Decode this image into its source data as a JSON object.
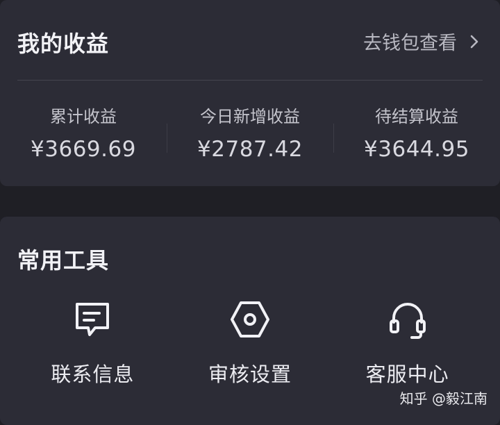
{
  "earnings": {
    "title": "我的收益",
    "wallet_link": "去钱包查看",
    "stats": [
      {
        "label": "累计收益",
        "value": "¥3669.69"
      },
      {
        "label": "今日新增收益",
        "value": "¥2787.42"
      },
      {
        "label": "待结算收益",
        "value": "¥3644.95"
      }
    ]
  },
  "tools": {
    "title": "常用工具",
    "items": [
      {
        "label": "联系信息",
        "icon": "message-icon"
      },
      {
        "label": "审核设置",
        "icon": "hex-nut-icon"
      },
      {
        "label": "客服中心",
        "icon": "headset-icon"
      }
    ]
  },
  "watermark": "知乎 @毅江南"
}
